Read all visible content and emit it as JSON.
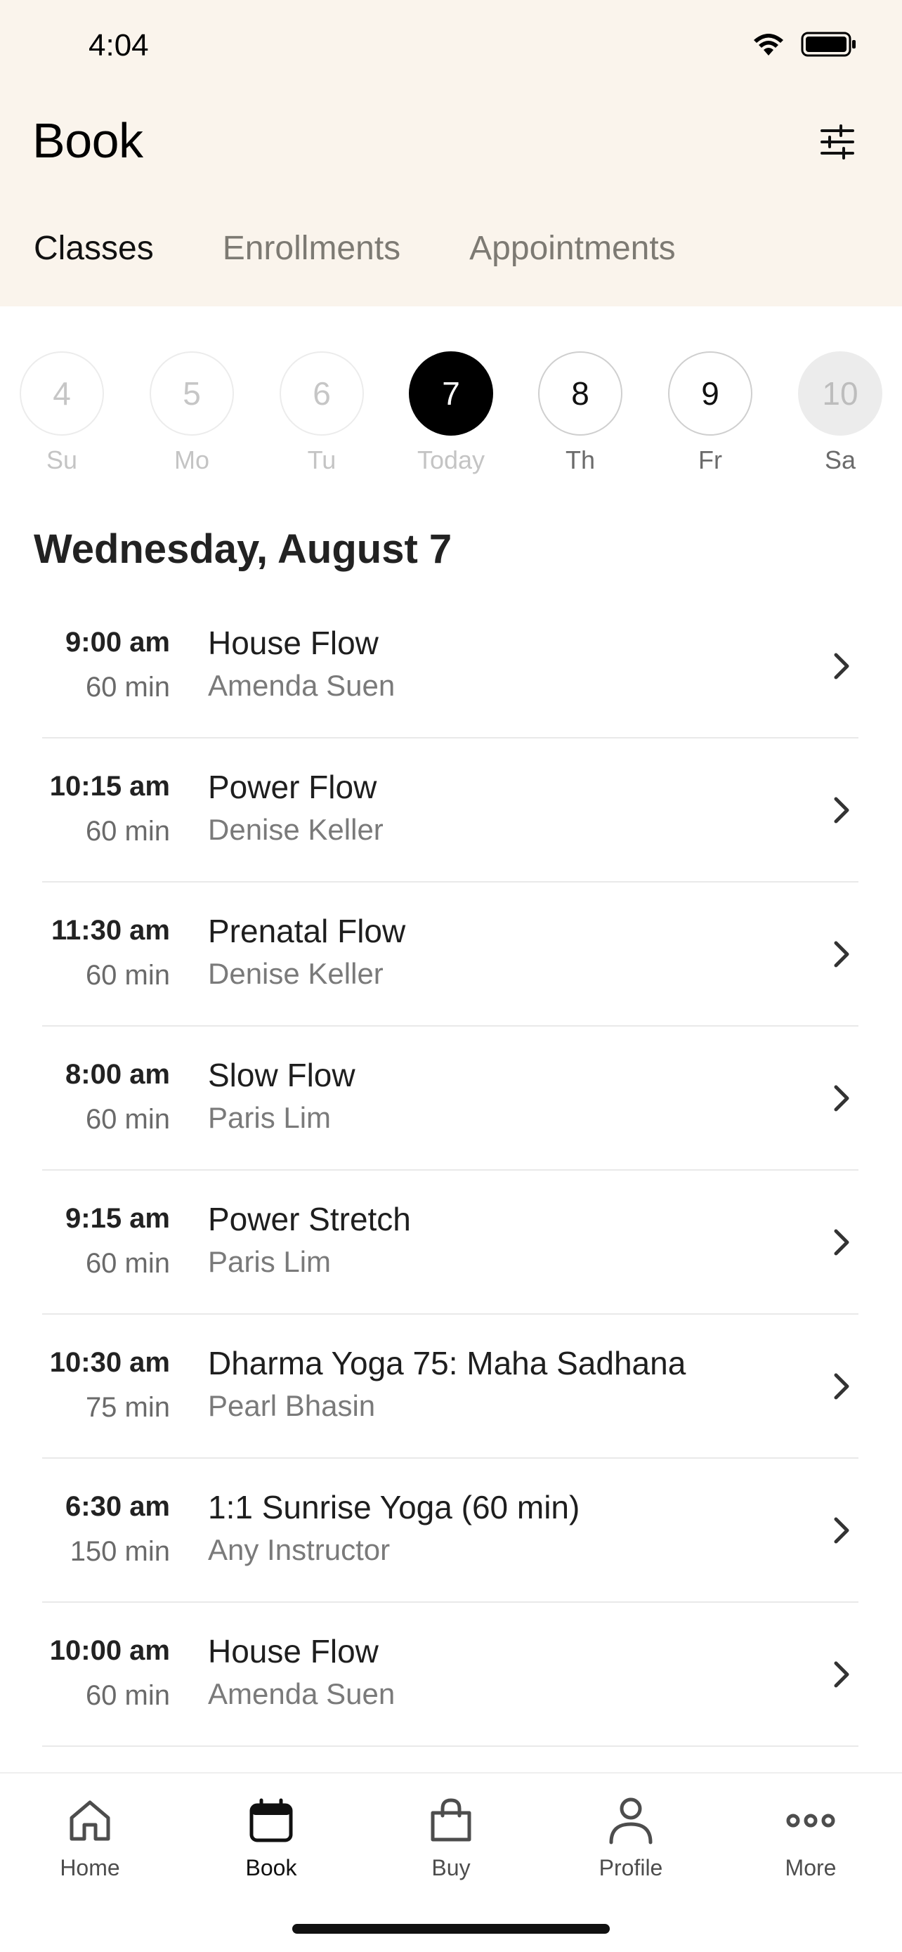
{
  "status_bar": {
    "time": "4:04"
  },
  "header": {
    "title": "Book",
    "filter_icon": "sliders-icon",
    "tabs": [
      {
        "label": "Classes",
        "active": true
      },
      {
        "label": "Enrollments",
        "active": false
      },
      {
        "label": "Appointments",
        "active": false
      }
    ]
  },
  "date_strip": {
    "days": [
      {
        "num": "4",
        "dow": "Su",
        "state": "past"
      },
      {
        "num": "5",
        "dow": "Mo",
        "state": "past"
      },
      {
        "num": "6",
        "dow": "Tu",
        "state": "past"
      },
      {
        "num": "7",
        "dow": "Today",
        "state": "today"
      },
      {
        "num": "8",
        "dow": "Th",
        "state": "future"
      },
      {
        "num": "9",
        "dow": "Fr",
        "state": "future"
      },
      {
        "num": "10",
        "dow": "Sa",
        "state": "disabled"
      }
    ]
  },
  "schedule": {
    "date_heading": "Wednesday, August 7",
    "classes": [
      {
        "time": "9:00 am",
        "duration": "60 min",
        "name": "House Flow",
        "instructor": "Amenda Suen"
      },
      {
        "time": "10:15 am",
        "duration": "60 min",
        "name": "Power Flow",
        "instructor": "Denise Keller"
      },
      {
        "time": "11:30 am",
        "duration": "60 min",
        "name": "Prenatal Flow",
        "instructor": "Denise Keller"
      },
      {
        "time": "8:00 am",
        "duration": "60 min",
        "name": "Slow Flow",
        "instructor": "Paris Lim"
      },
      {
        "time": "9:15 am",
        "duration": "60 min",
        "name": "Power Stretch",
        "instructor": "Paris Lim"
      },
      {
        "time": "10:30 am",
        "duration": "75 min",
        "name": "Dharma Yoga 75: Maha Sadhana",
        "instructor": "Pearl Bhasin"
      },
      {
        "time": "6:30 am",
        "duration": "150 min",
        "name": "1:1 Sunrise Yoga (60 min)",
        "instructor": "Any Instructor"
      },
      {
        "time": "10:00 am",
        "duration": "60 min",
        "name": "House Flow",
        "instructor": "Amenda Suen"
      }
    ]
  },
  "bottom_nav": {
    "items": [
      {
        "label": "Home",
        "icon": "home-icon",
        "active": false
      },
      {
        "label": "Book",
        "icon": "calendar-icon",
        "active": true
      },
      {
        "label": "Buy",
        "icon": "shopping-bag-icon",
        "active": false
      },
      {
        "label": "Profile",
        "icon": "person-icon",
        "active": false
      },
      {
        "label": "More",
        "icon": "more-dots-icon",
        "active": false
      }
    ]
  },
  "colors": {
    "header_bg": "#faf4ec",
    "accent": "#000000",
    "muted_text": "#7a7a7a"
  }
}
